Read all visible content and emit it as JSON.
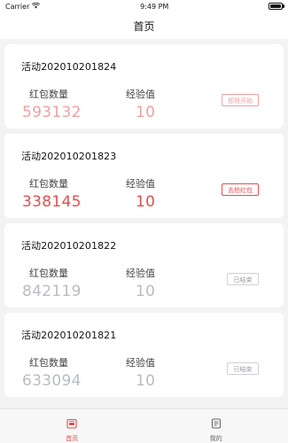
{
  "status_bar": {
    "carrier": "Carrier",
    "time": "9:49 PM"
  },
  "nav": {
    "title": "首页"
  },
  "colors": {
    "accent": "#e74c4c",
    "accent_faded": "#f2a0a0",
    "ended_text": "#b9bcc2",
    "ended_button_text": "#9a9da3",
    "ended_button_border": "#cfd2d6",
    "tab_active": "#e74c4c",
    "tab_inactive": "#666666"
  },
  "cards": [
    {
      "title": "活动202010201824",
      "amount_label": "红包数量",
      "amount": "593132",
      "exp_label": "经验值",
      "exp": "10",
      "button": "即将开始",
      "state": "upcoming"
    },
    {
      "title": "活动202010201823",
      "amount_label": "红包数量",
      "amount": "338145",
      "exp_label": "经验值",
      "exp": "10",
      "button": "去抢红包",
      "state": "active"
    },
    {
      "title": "活动202010201822",
      "amount_label": "红包数量",
      "amount": "842119",
      "exp_label": "经验值",
      "exp": "10",
      "button": "已结束",
      "state": "ended"
    },
    {
      "title": "活动202010201821",
      "amount_label": "红包数量",
      "amount": "633094",
      "exp_label": "经验值",
      "exp": "10",
      "button": "已结束",
      "state": "ended"
    }
  ],
  "tabs": [
    {
      "label": "首页",
      "icon": "home-icon",
      "active": true
    },
    {
      "label": "我的",
      "icon": "document-icon",
      "active": false
    }
  ]
}
